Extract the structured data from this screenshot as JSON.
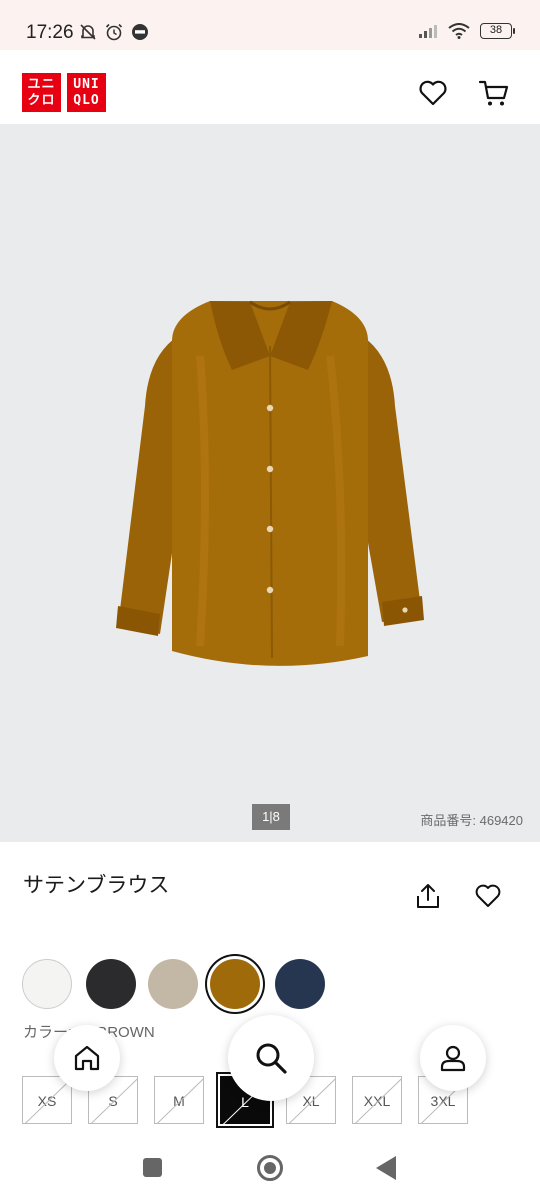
{
  "status_bar": {
    "time": "17:26",
    "battery": "38",
    "icons": [
      "mute-bell-icon",
      "alarm-icon",
      "line-icon",
      "signal-icon",
      "wifi-icon",
      "battery-icon"
    ]
  },
  "header": {
    "logo_left": [
      "ユニ",
      "クロ"
    ],
    "logo_right": [
      "UNI",
      "QLO"
    ],
    "brand_color": "#e60012",
    "icons": [
      "heart-icon",
      "cart-icon"
    ]
  },
  "product": {
    "image_alt": "brown satin blouse",
    "page_indicator": "1|8",
    "product_number": "商品番号: 469420",
    "title": "サテンブラウス",
    "selected_color_label": "カラー: 38 BROWN"
  },
  "colors": [
    {
      "name": "white",
      "hex": "#f4f4f2",
      "selected": false
    },
    {
      "name": "black",
      "hex": "#2b2b2d",
      "selected": false
    },
    {
      "name": "beige",
      "hex": "#c3b7a6",
      "selected": false
    },
    {
      "name": "brown",
      "hex": "#9e6a0a",
      "selected": true
    },
    {
      "name": "navy",
      "hex": "#263650",
      "selected": false
    }
  ],
  "sizes": [
    {
      "label": "XS",
      "selected": false,
      "unavailable": true
    },
    {
      "label": "S",
      "selected": false,
      "unavailable": true
    },
    {
      "label": "M",
      "selected": false,
      "unavailable": true
    },
    {
      "label": "L",
      "selected": true,
      "unavailable": true
    },
    {
      "label": "XL",
      "selected": false,
      "unavailable": true
    },
    {
      "label": "XXL",
      "selected": false,
      "unavailable": true
    },
    {
      "label": "3XL",
      "selected": false,
      "unavailable": true
    }
  ],
  "floating_nav": [
    "home-icon",
    "search-icon",
    "user-icon"
  ]
}
